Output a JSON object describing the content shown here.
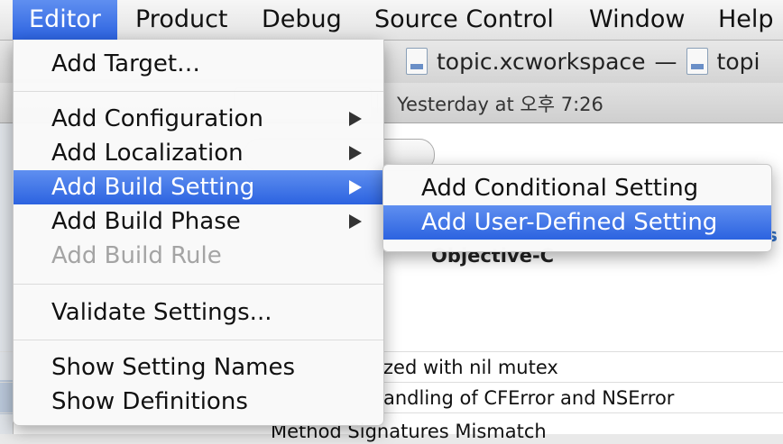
{
  "menubar": {
    "items": [
      "Editor",
      "Product",
      "Debug",
      "Source Control",
      "Window",
      "Help"
    ]
  },
  "window": {
    "title": "topic.xcworkspace",
    "title_sep": "—",
    "title_second": "topi",
    "timestamp": "Yesterday at 오후 7:26"
  },
  "editor_menu": {
    "add_target": "Add Target…",
    "add_configuration": "Add Configuration",
    "add_localization": "Add Localization",
    "add_build_setting": "Add Build Setting",
    "add_build_phase": "Add Build Phase",
    "add_build_rule": "Add Build Rule",
    "validate_settings": "Validate Settings...",
    "show_setting_names": "Show Setting Names",
    "show_definitions": "Show Definitions"
  },
  "submenu": {
    "add_conditional": "Add Conditional Setting",
    "add_user_defined": "Add User-Defined Setting"
  },
  "content": {
    "group_header": "Objective-C",
    "rows": [
      "zed with nil mutex",
      "andling of CFError and NSError",
      "Method Signatures Mismatch"
    ]
  }
}
